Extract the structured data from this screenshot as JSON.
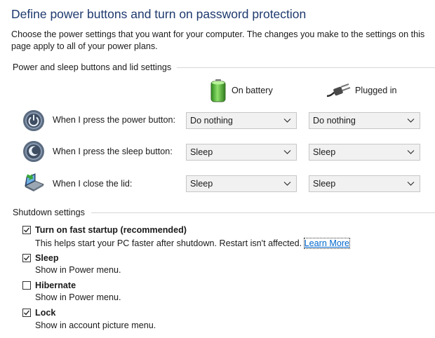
{
  "page": {
    "title": "Define power buttons and turn on password protection",
    "description": "Choose the power settings that you want for your computer. The changes you make to the settings on this page apply to all of your power plans."
  },
  "power_section": {
    "title": "Power and sleep buttons and lid settings",
    "columns": {
      "battery": {
        "label": "On battery",
        "icon": "battery-icon"
      },
      "plugged": {
        "label": "Plugged in",
        "icon": "plug-icon"
      }
    },
    "rows": [
      {
        "label": "When I press the power button:",
        "icon": "power-button-icon",
        "battery": "Do nothing",
        "plugged": "Do nothing"
      },
      {
        "label": "When I press the sleep button:",
        "icon": "sleep-button-icon",
        "battery": "Sleep",
        "plugged": "Sleep"
      },
      {
        "label": "When I close the lid:",
        "icon": "laptop-lid-icon",
        "battery": "Sleep",
        "plugged": "Sleep"
      }
    ]
  },
  "shutdown_section": {
    "title": "Shutdown settings",
    "items": [
      {
        "label": "Turn on fast startup (recommended)",
        "desc": "This helps start your PC faster after shutdown. Restart isn't affected.",
        "link": "Learn More",
        "checked": true
      },
      {
        "label": "Sleep",
        "desc": "Show in Power menu.",
        "checked": true
      },
      {
        "label": "Hibernate",
        "desc": "Show in Power menu.",
        "checked": false
      },
      {
        "label": "Lock",
        "desc": "Show in account picture menu.",
        "checked": true
      }
    ]
  }
}
